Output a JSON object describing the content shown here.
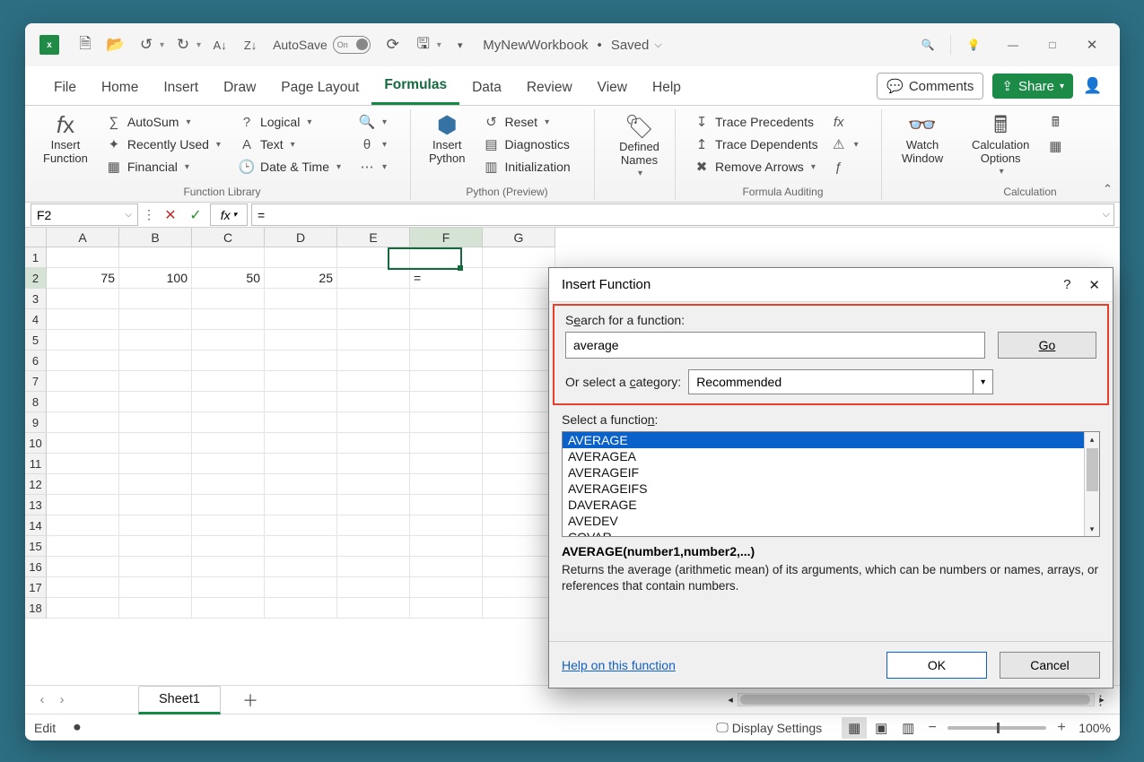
{
  "title": {
    "workbook": "MyNewWorkbook",
    "state": "Saved"
  },
  "qat": {
    "autosave_label": "AutoSave",
    "autosave_pill": "On"
  },
  "tabs": {
    "file": "File",
    "home": "Home",
    "insert": "Insert",
    "draw": "Draw",
    "page_layout": "Page Layout",
    "formulas": "Formulas",
    "data": "Data",
    "review": "Review",
    "view": "View",
    "help": "Help"
  },
  "tabright": {
    "comments": "Comments",
    "share": "Share"
  },
  "ribbon": {
    "insert_function": "Insert\nFunction",
    "autosum": "AutoSum",
    "recently": "Recently Used",
    "financial": "Financial",
    "logical": "Logical",
    "text": "Text",
    "datetime": "Date & Time",
    "group_library": "Function Library",
    "insert_python": "Insert\nPython",
    "reset": "Reset",
    "diagnostics": "Diagnostics",
    "initialization": "Initialization",
    "group_python": "Python (Preview)",
    "defined_names": "Defined\nNames",
    "trace_prec": "Trace Precedents",
    "trace_dep": "Trace Dependents",
    "remove_arrows": "Remove Arrows",
    "group_auditing": "Formula Auditing",
    "watch_window": "Watch\nWindow",
    "calc_options": "Calculation\nOptions",
    "group_calc": "Calculation"
  },
  "namebox": {
    "ref": "F2",
    "formula": "="
  },
  "columns": [
    "A",
    "B",
    "C",
    "D",
    "E",
    "F",
    "G"
  ],
  "rows": [
    1,
    2,
    3,
    4,
    5,
    6,
    7,
    8,
    9,
    10,
    11,
    12,
    13,
    14,
    15,
    16,
    17,
    18
  ],
  "cells": {
    "A2": "75",
    "B2": "100",
    "C2": "50",
    "D2": "25",
    "F2": "="
  },
  "active_cell": "F2",
  "sheet": {
    "name": "Sheet1"
  },
  "status": {
    "mode": "Edit",
    "display_settings": "Display Settings",
    "zoom": "100%"
  },
  "dialog": {
    "title": "Insert Function",
    "search_label_pre": "S",
    "search_label_ul": "e",
    "search_label_post": "arch for a function:",
    "search_value": "average",
    "go": "Go",
    "category_label_pre": "Or select a ",
    "category_label_ul": "c",
    "category_label_post": "ategory:",
    "category_value": "Recommended",
    "select_label_pre": "Select a functio",
    "select_label_ul": "n",
    "select_label_post": ":",
    "functions": [
      "AVERAGE",
      "AVERAGEA",
      "AVERAGEIF",
      "AVERAGEIFS",
      "DAVERAGE",
      "AVEDEV",
      "COVAR"
    ],
    "signature": "AVERAGE(number1,number2,...)",
    "description": "Returns the average (arithmetic mean) of its arguments, which can be numbers or names, arrays, or references that contain numbers.",
    "help_link": "Help on this function",
    "ok": "OK",
    "cancel": "Cancel"
  }
}
